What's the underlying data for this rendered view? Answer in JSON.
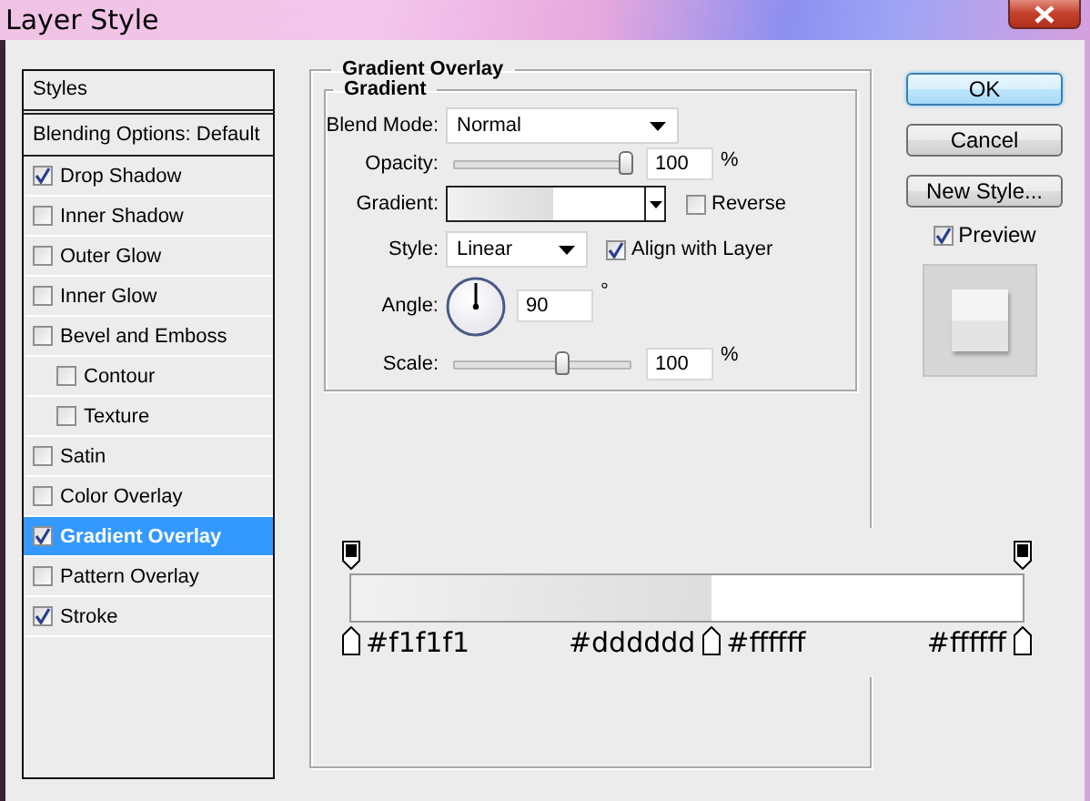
{
  "window": {
    "title": "Layer Style"
  },
  "sidebar": {
    "header": "Styles",
    "items": [
      {
        "label": "Blending Options: Default",
        "kind": "plain",
        "selected": false
      },
      {
        "label": "Drop Shadow",
        "kind": "check",
        "checked": true,
        "selected": false
      },
      {
        "label": "Inner Shadow",
        "kind": "check",
        "checked": false,
        "selected": false
      },
      {
        "label": "Outer Glow",
        "kind": "check",
        "checked": false,
        "selected": false
      },
      {
        "label": "Inner Glow",
        "kind": "check",
        "checked": false,
        "selected": false
      },
      {
        "label": "Bevel and Emboss",
        "kind": "check",
        "checked": false,
        "selected": false,
        "children": [
          {
            "label": "Contour",
            "kind": "check",
            "checked": false,
            "selected": false
          },
          {
            "label": "Texture",
            "kind": "check",
            "checked": false,
            "selected": false
          }
        ]
      },
      {
        "label": "Satin",
        "kind": "check",
        "checked": false,
        "selected": false
      },
      {
        "label": "Color Overlay",
        "kind": "check",
        "checked": false,
        "selected": false
      },
      {
        "label": "Gradient Overlay",
        "kind": "check",
        "checked": true,
        "selected": true
      },
      {
        "label": "Pattern Overlay",
        "kind": "check",
        "checked": false,
        "selected": false
      },
      {
        "label": "Stroke",
        "kind": "check",
        "checked": true,
        "selected": false
      }
    ]
  },
  "panel": {
    "title": "Gradient Overlay",
    "group": {
      "title": "Gradient",
      "blend_mode": {
        "label": "Blend Mode:",
        "value": "Normal"
      },
      "opacity": {
        "label": "Opacity:",
        "level": 0.98,
        "value": "100",
        "unit": "%"
      },
      "gradient": {
        "label": "Gradient:"
      },
      "reverse": {
        "label": "Reverse",
        "checked": false
      },
      "style": {
        "label": "Style:",
        "value": "Linear"
      },
      "align": {
        "label": "Align with Layer",
        "checked": true
      },
      "angle": {
        "label": "Angle:",
        "value": "90",
        "unit": "°"
      },
      "scale": {
        "label": "Scale:",
        "level": 0.61,
        "value": "100",
        "unit": "%"
      }
    }
  },
  "buttons": [
    {
      "label": "OK",
      "default": true
    },
    {
      "label": "Cancel",
      "default": false
    },
    {
      "label": "New Style...",
      "default": false
    }
  ],
  "preview": {
    "label": "Preview",
    "checked": true
  },
  "gradient_editor": {
    "opacity_stops": [
      {
        "level": 0
      },
      {
        "level": 1
      }
    ],
    "color_stops": [
      {
        "level": 0,
        "right": {
          "text": "#f1f1f1",
          "color": "#f1f1f1"
        }
      },
      {
        "level": 0.537,
        "left": {
          "text": "#dddddd",
          "color": "#dddddd"
        },
        "right": {
          "text": "#ffffff",
          "color": "#ffffff"
        }
      },
      {
        "level": 1,
        "left": {
          "text": "#ffffff",
          "color": "#ffffff"
        }
      }
    ]
  }
}
